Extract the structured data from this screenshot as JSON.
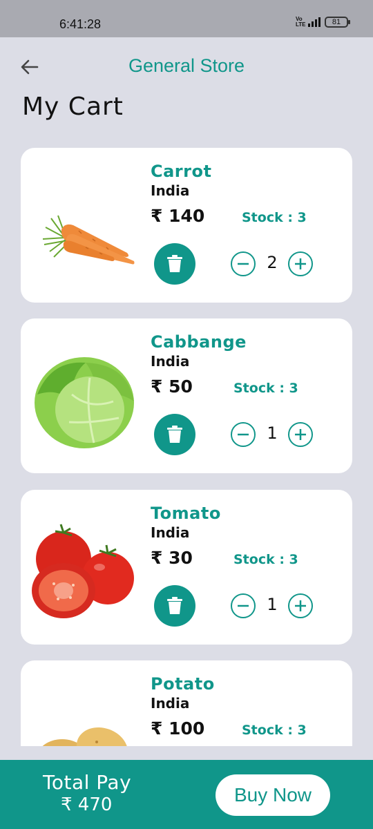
{
  "status_bar": {
    "time": "6:41:28",
    "network": "Vo LTE",
    "battery": "81"
  },
  "header": {
    "store_name": "General Store",
    "page_title": "My Cart"
  },
  "cart": {
    "items": [
      {
        "name": "Carrot",
        "origin": "India",
        "price": "₹ 140",
        "stock": "Stock : 3",
        "quantity": "2",
        "image": "carrot-image"
      },
      {
        "name": "Cabbange",
        "origin": "India",
        "price": "₹ 50",
        "stock": "Stock : 3",
        "quantity": "1",
        "image": "cabbage-image"
      },
      {
        "name": "Tomato",
        "origin": "India",
        "price": "₹ 30",
        "stock": "Stock : 3",
        "quantity": "1",
        "image": "tomato-image"
      },
      {
        "name": "Potato",
        "origin": "India",
        "price": "₹ 100",
        "stock": "Stock : 3",
        "image": "potato-image"
      }
    ]
  },
  "footer": {
    "total_label": "Total Pay",
    "total_value": "₹ 470",
    "buy_label": "Buy Now"
  },
  "colors": {
    "accent": "#10968a",
    "background": "#dcdde6",
    "card": "#ffffff"
  }
}
